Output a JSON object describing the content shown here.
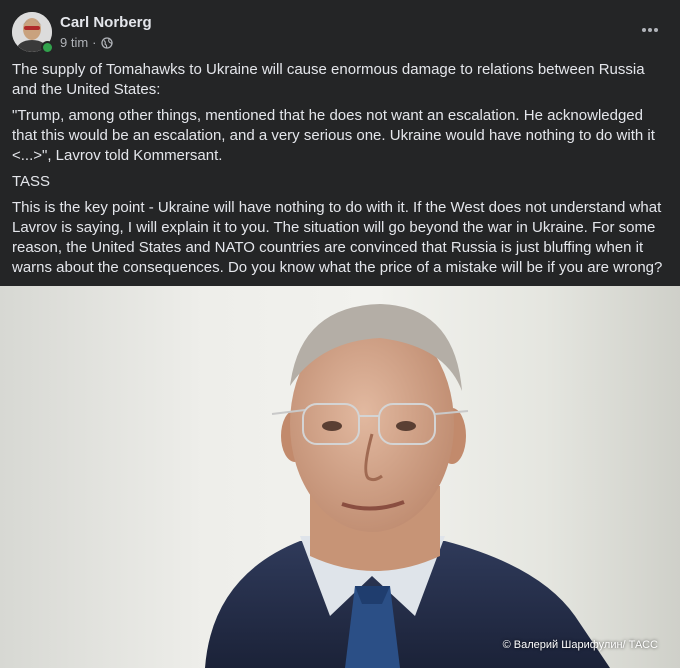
{
  "post": {
    "author": "Carl Norberg",
    "time": "9 tim",
    "separator": "·",
    "privacy_icon": "globe-icon",
    "more_icon": "more-options-icon",
    "online_status_color": "#31a24c",
    "paragraphs": [
      "The supply of Tomahawks to Ukraine will cause enormous damage to relations between Russia and the United States:",
      "\"Trump, among other things, mentioned that he does not want an escalation. He acknowledged that this would be an escalation, and a very serious one. Ukraine would have nothing to do with it <...>\", Lavrov told Kommersant.",
      "TASS",
      "This is the key point - Ukraine will have nothing to do with it. If the West does not understand what Lavrov is saying, I will explain it to you. The situation will go beyond the war in Ukraine. For some reason, the United States and NATO countries are convinced that Russia is just bluffing when it warns about the consequences. Do you know what the price of a mistake will be if you are wrong?"
    ],
    "photo_credit": "© Валерий Шарифулин/ ТАСС"
  },
  "colors": {
    "background": "#242526",
    "primary_text": "#e4e6eb",
    "secondary_text": "#b0b3b8"
  }
}
